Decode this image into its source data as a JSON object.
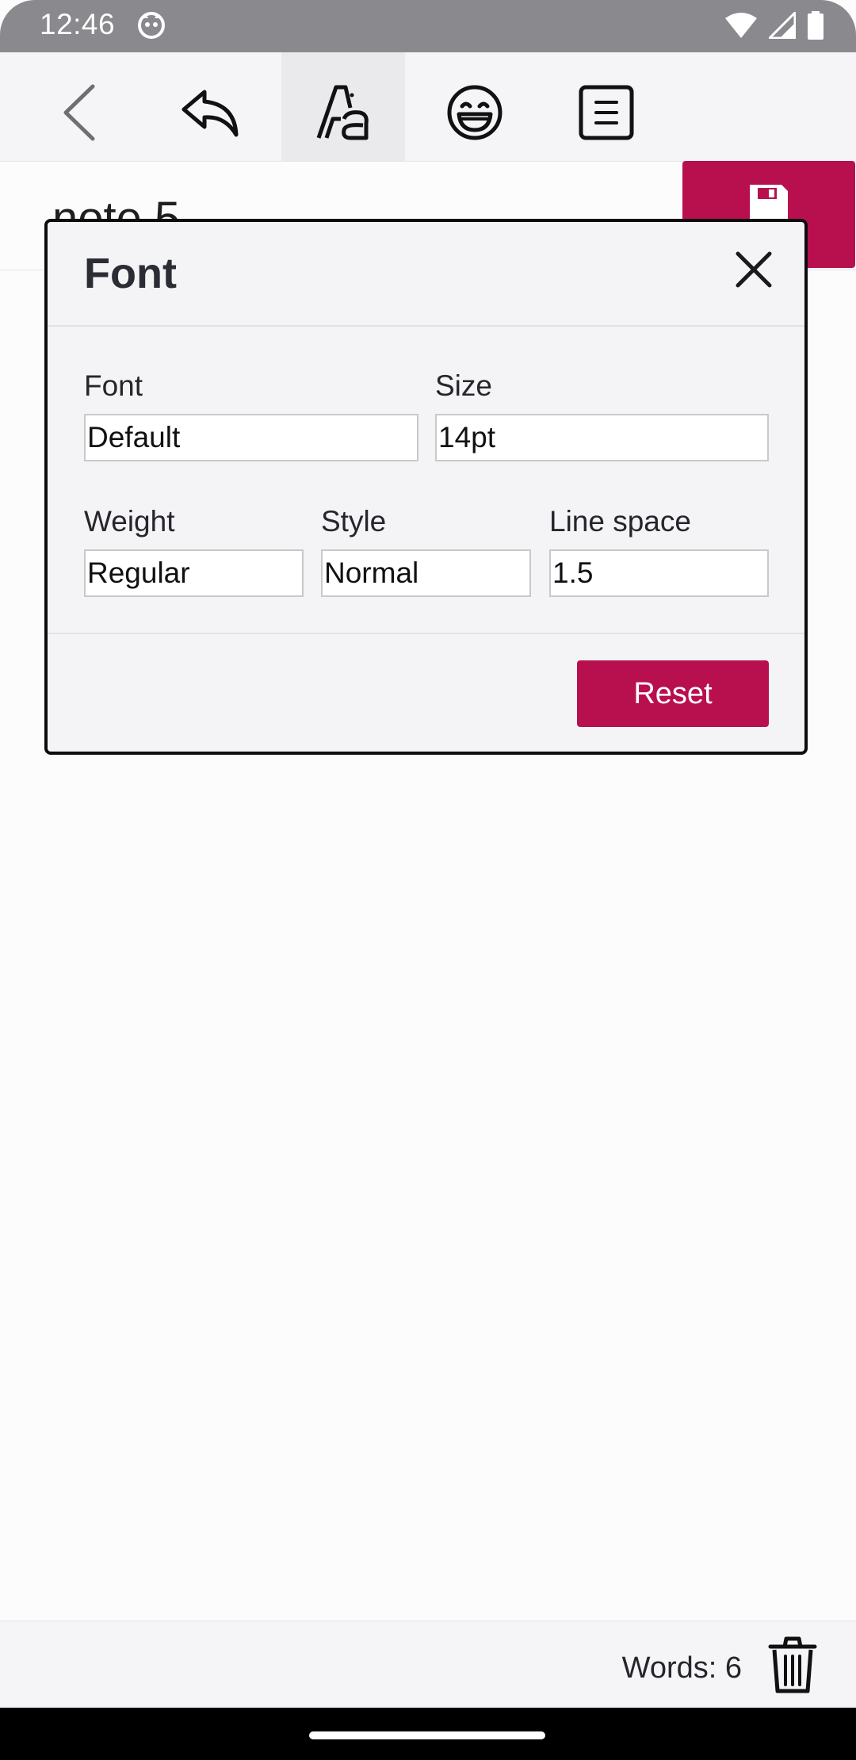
{
  "status_bar": {
    "time": "12:46",
    "icons": [
      "app-notification-icon",
      "wifi-icon",
      "signal-icon",
      "battery-icon"
    ]
  },
  "toolbar": {
    "buttons": [
      {
        "name": "back",
        "icon": "chevron-left-icon"
      },
      {
        "name": "undo",
        "icon": "undo-arrow-icon"
      },
      {
        "name": "font",
        "icon": "font-style-icon",
        "active": true
      },
      {
        "name": "emoji",
        "icon": "smiley-icon"
      },
      {
        "name": "format",
        "icon": "text-align-icon"
      }
    ]
  },
  "note": {
    "title": "note 5"
  },
  "save_button": {
    "icon": "floppy-disk-icon",
    "color": "#b8104f"
  },
  "font_dialog": {
    "title": "Font",
    "fields": {
      "font": {
        "label": "Font",
        "value": "Default"
      },
      "size": {
        "label": "Size",
        "value": "14pt"
      },
      "weight": {
        "label": "Weight",
        "value": "Regular"
      },
      "style": {
        "label": "Style",
        "value": "Normal"
      },
      "line_space": {
        "label": "Line space",
        "value": "1.5"
      }
    },
    "reset_label": "Reset",
    "accent_color": "#b8104f"
  },
  "footer": {
    "word_count": "Words: 6",
    "delete_icon": "trash-icon"
  }
}
